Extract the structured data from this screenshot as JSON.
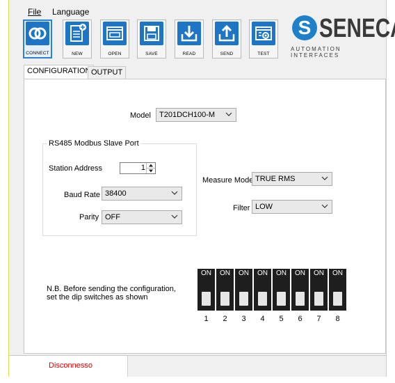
{
  "menu": {
    "file": "File",
    "language": "Language"
  },
  "toolbar": {
    "buttons": [
      {
        "label": "CONNECT",
        "icon": "connect-icon"
      },
      {
        "label": "NEW",
        "icon": "new-document-icon"
      },
      {
        "label": "OPEN",
        "icon": "open-window-icon"
      },
      {
        "label": "SAVE",
        "icon": "save-disk-icon"
      },
      {
        "label": "READ",
        "icon": "download-arrow-icon"
      },
      {
        "label": "SEND",
        "icon": "upload-arrow-icon"
      },
      {
        "label": "TEST",
        "icon": "test-gear-icon"
      }
    ]
  },
  "logo": {
    "letter": "S",
    "name": "SENECA",
    "tagline": "AUTOMATION INTERFACES",
    "color": "#1e80c8"
  },
  "tabs": [
    {
      "label": "CONFIGURATION"
    },
    {
      "label": "OUTPUT"
    }
  ],
  "config": {
    "model_label": "Model",
    "model_value": "T201DCH100-M",
    "group_title": "RS485 Modbus Slave Port",
    "station_label": "Station Address",
    "station_value": "1",
    "baud_label": "Baud Rate",
    "baud_value": "38400",
    "parity_label": "Parity",
    "parity_value": "OFF",
    "measure_label": "Measure Mode",
    "measure_value": "TRUE RMS",
    "filter_label": "Filter",
    "filter_value": "LOW",
    "note_line1": "N.B. Before sending the configuration,",
    "note_line2": "set the dip switches as shown",
    "dip_on": "ON",
    "dip_numbers": [
      "1",
      "2",
      "3",
      "4",
      "5",
      "6",
      "7",
      "8"
    ]
  },
  "status": {
    "text": "Disconnesso",
    "color": "#e00000"
  }
}
